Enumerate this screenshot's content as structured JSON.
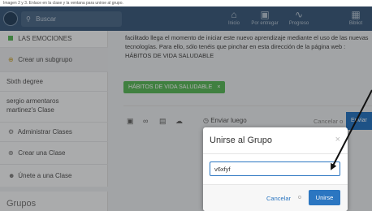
{
  "caption": "Imagen 2 y 3. Enlace en la clase y la ventana para unirse al grupo.",
  "topbar": {
    "search_placeholder": "Buscar",
    "nav": [
      {
        "label": "Inicio",
        "icon": "home-icon"
      },
      {
        "label": "Por entregar",
        "icon": "inbox-icon"
      },
      {
        "label": "Progreso",
        "icon": "activity-icon"
      },
      {
        "label": "Bibliot",
        "icon": "library-icon"
      }
    ]
  },
  "sidebar": {
    "items": [
      {
        "label": "LAS EMOCIONES",
        "icon": "green-square-icon"
      },
      {
        "label": "Crear un subgrupo",
        "icon": "plus-circle-icon"
      },
      {
        "label": "Sixth degree"
      },
      {
        "label": "sergio armentaros martinez's Clase"
      },
      {
        "label": "Administrar Clases",
        "icon": "gear-icon"
      },
      {
        "label": "Crear una Clase",
        "icon": "plus-circle-icon"
      },
      {
        "label": "Únete a una Clase",
        "icon": "users-icon"
      }
    ],
    "section_title": "Grupos"
  },
  "post": {
    "text": "facilitado llega el momento de iniciar este nuevo aprendizaje mediante el uso de las nuevas tecnologías. Para ello, sólo tenéis que pinchar en esta dirección de la página web : HÁBITOS DE VIDA SALUDABLE",
    "tag": "HÁBITOS DE VIDA SALUDABLE",
    "send_later": "Enviar luego",
    "cancel": "Cancelar",
    "or": "o",
    "send": "Enviar"
  },
  "modal": {
    "title": "Unirse al Grupo",
    "close": "×",
    "input_value": "v6xfyf",
    "cancel": "Cancelar",
    "or": "o",
    "join": "Unirse"
  },
  "colors": {
    "topbar": "#3f5d7e",
    "accent": "#2b76c1",
    "tag": "#5cb85c"
  }
}
